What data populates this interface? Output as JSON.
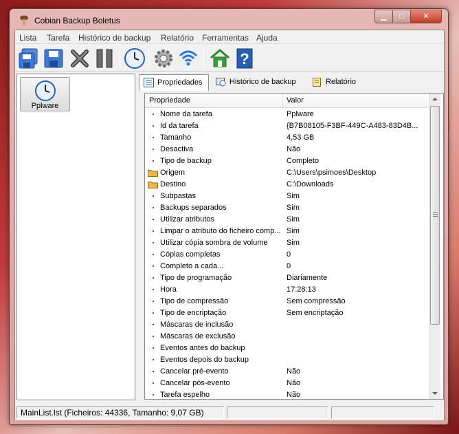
{
  "window": {
    "title": "Cobian Backup Boletus"
  },
  "menu": [
    "Lista",
    "Tarefa",
    "Histórico de backup",
    "Relatório",
    "Ferramentas",
    "Ajuda"
  ],
  "task": {
    "name": "Pplware"
  },
  "tabs": [
    {
      "label": "Propriedades",
      "icon": "properties-icon",
      "active": true
    },
    {
      "label": "Histórico de backup",
      "icon": "history-icon",
      "active": false
    },
    {
      "label": "Relatório",
      "icon": "report-icon",
      "active": false
    }
  ],
  "grid": {
    "headers": [
      "Propriedade",
      "Valor"
    ],
    "rows": [
      {
        "prop": "Nome da tarefa",
        "val": "Pplware",
        "icon": "dot"
      },
      {
        "prop": "Id da tarefa",
        "val": "{B7B08105-F3BF-449C-A483-83D4B...",
        "icon": "dot"
      },
      {
        "prop": "Tamanho",
        "val": "4,53 GB",
        "icon": "dot"
      },
      {
        "prop": "Desactiva",
        "val": "Não",
        "icon": "dot"
      },
      {
        "prop": "Tipo de backup",
        "val": "Completo",
        "icon": "dot"
      },
      {
        "prop": "Origem",
        "val": "C:\\Users\\psimoes\\Desktop",
        "icon": "folder"
      },
      {
        "prop": "Destino",
        "val": "C:\\Downloads",
        "icon": "folder"
      },
      {
        "prop": "Subpastas",
        "val": "Sim",
        "icon": "dot"
      },
      {
        "prop": "Backups separados",
        "val": "Sim",
        "icon": "dot"
      },
      {
        "prop": "Utilizar atributos",
        "val": "Sim",
        "icon": "dot"
      },
      {
        "prop": "Limpar o atributo do ficheiro comp...",
        "val": "Sim",
        "icon": "dot"
      },
      {
        "prop": "Utilizar cópia sombra de volume",
        "val": "Sim",
        "icon": "dot"
      },
      {
        "prop": "Cópias completas",
        "val": "0",
        "icon": "dot"
      },
      {
        "prop": "Completo a cada...",
        "val": "0",
        "icon": "dot"
      },
      {
        "prop": "Tipo de programação",
        "val": "Diariamente",
        "icon": "dot"
      },
      {
        "prop": "Hora",
        "val": "17:28:13",
        "icon": "dot"
      },
      {
        "prop": "Tipo de compressão",
        "val": "Sem compressão",
        "icon": "dot"
      },
      {
        "prop": "Tipo de encriptação",
        "val": "Sem encriptação",
        "icon": "dot"
      },
      {
        "prop": "Máscaras de inclusão",
        "val": "",
        "icon": "dot"
      },
      {
        "prop": "Máscaras de exclusão",
        "val": "",
        "icon": "dot"
      },
      {
        "prop": "Eventos antes do backup",
        "val": "",
        "icon": "dot"
      },
      {
        "prop": "Eventos depois do backup",
        "val": "",
        "icon": "dot"
      },
      {
        "prop": "Cancelar pré-evento",
        "val": "Não",
        "icon": "dot"
      },
      {
        "prop": "Cancelar pós-evento",
        "val": "Não",
        "icon": "dot"
      },
      {
        "prop": "Tarefa espelho",
        "val": "Não",
        "icon": "dot"
      }
    ]
  },
  "status": {
    "text": "MainList.lst (Ficheiros: 44336, Tamanho: 9,07 GB)"
  },
  "colors": {
    "accent": "#2a5fb0",
    "folder": "#e8b94a",
    "home": "#3aa13a"
  }
}
